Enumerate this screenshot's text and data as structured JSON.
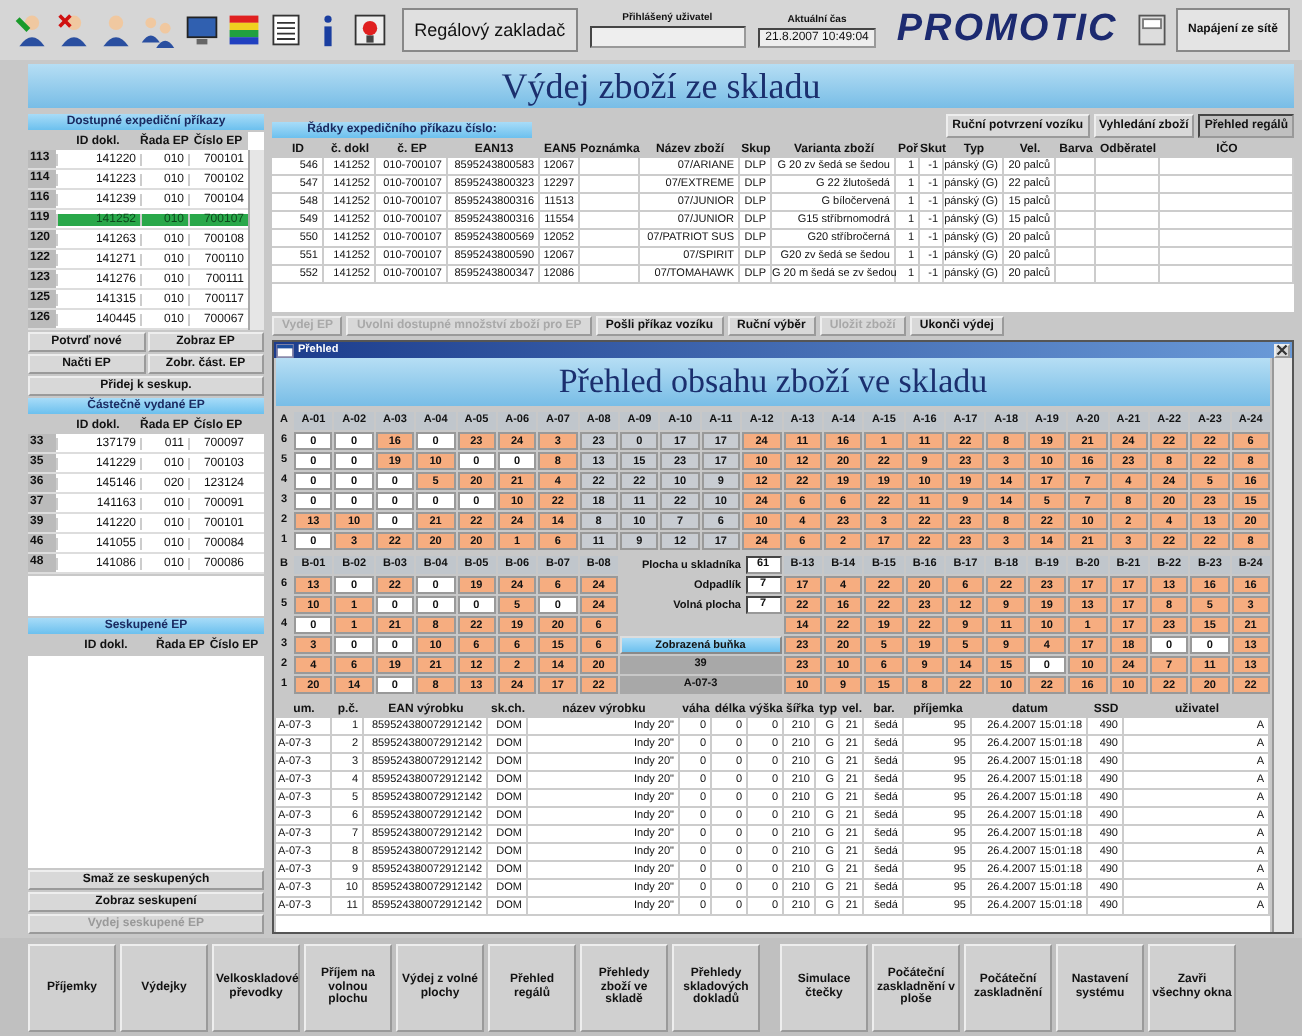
{
  "toolbar": {
    "app_label": "Regálový zakladač",
    "user_label": "Přihlášený uživatel",
    "time_label": "Aktuální čas",
    "time": "21.8.2007 10:49:04",
    "logo": "PROMOTIC",
    "power": "Napájení ze sítě"
  },
  "title": "Výdej zboží ze skladu",
  "available_orders": {
    "title": "Dostupné expediční příkazy",
    "columns": [
      "ID dokl.",
      "Řada EP",
      "Číslo EP"
    ],
    "rows": [
      {
        "n": "113",
        "cells": [
          "141220",
          "010",
          "700101"
        ],
        "selected": false
      },
      {
        "n": "114",
        "cells": [
          "141223",
          "010",
          "700102"
        ],
        "selected": false
      },
      {
        "n": "116",
        "cells": [
          "141239",
          "010",
          "700104"
        ],
        "selected": false
      },
      {
        "n": "119",
        "cells": [
          "141252",
          "010",
          "700107"
        ],
        "selected": true
      },
      {
        "n": "120",
        "cells": [
          "141263",
          "010",
          "700108"
        ],
        "selected": false
      },
      {
        "n": "122",
        "cells": [
          "141271",
          "010",
          "700110"
        ],
        "selected": false
      },
      {
        "n": "123",
        "cells": [
          "141276",
          "010",
          "700111"
        ],
        "selected": false
      },
      {
        "n": "125",
        "cells": [
          "141315",
          "010",
          "700117"
        ],
        "selected": false
      },
      {
        "n": "126",
        "cells": [
          "140445",
          "010",
          "700067"
        ],
        "selected": false
      }
    ],
    "buttons": [
      "Potvrď nové",
      "Zobraz EP",
      "Načti EP",
      "Zobr. část. EP",
      "Přidej k seskup."
    ]
  },
  "partial_orders": {
    "title": "Částečně vydané EP",
    "columns": [
      "ID dokl.",
      "Řada EP",
      "Číslo EP"
    ],
    "rows": [
      {
        "n": "33",
        "cells": [
          "137179",
          "011",
          "700097"
        ]
      },
      {
        "n": "35",
        "cells": [
          "141229",
          "010",
          "700103"
        ]
      },
      {
        "n": "36",
        "cells": [
          "145146",
          "020",
          "123124"
        ]
      },
      {
        "n": "37",
        "cells": [
          "141163",
          "010",
          "700091"
        ]
      },
      {
        "n": "39",
        "cells": [
          "141220",
          "010",
          "700101"
        ]
      },
      {
        "n": "46",
        "cells": [
          "141055",
          "010",
          "700084"
        ]
      },
      {
        "n": "48",
        "cells": [
          "141086",
          "010",
          "700086"
        ]
      }
    ]
  },
  "grouped_orders": {
    "title": "Seskupené EP",
    "columns": [
      "ID dokl.",
      "Řada EP",
      "Číslo EP"
    ],
    "buttons": [
      {
        "label": "Smaž ze seskupených",
        "disabled": false
      },
      {
        "label": "Zobraz seskupení",
        "disabled": false
      },
      {
        "label": "Vydej seskupené EP",
        "disabled": true
      }
    ]
  },
  "order_lines": {
    "title": "Řádky expedičního příkazu číslo:",
    "tabs": [
      {
        "label": "Ruční potvrzení vozíku",
        "selected": false
      },
      {
        "label": "Vyhledání zboží",
        "selected": false
      },
      {
        "label": "Přehled regálů",
        "selected": true
      }
    ],
    "columns": [
      "ID",
      "č. dokl",
      "č. EP",
      "EAN13",
      "EAN5",
      "Poznámka",
      "Název zboží",
      "Skup",
      "Varianta zboží",
      "Poř",
      "Skut",
      "Typ",
      "Vel.",
      "Barva",
      "Odběratel",
      "IČO"
    ],
    "rows": [
      [
        "546",
        "141252",
        "010-700107",
        "8595243800583",
        "12067",
        "",
        "07/ARIANE",
        "DLP",
        "G 20 zv šedá se šedou",
        "1",
        "-1",
        "pánský (G)",
        "20 palců",
        "",
        "",
        ""
      ],
      [
        "547",
        "141252",
        "010-700107",
        "8595243800323",
        "12297",
        "",
        "07/EXTREME",
        "DLP",
        "G 22 žlutošedá",
        "1",
        "-1",
        "pánský (G)",
        "22 palců",
        "",
        "",
        ""
      ],
      [
        "548",
        "141252",
        "010-700107",
        "8595243800316",
        "11513",
        "",
        "07/JUNIOR",
        "DLP",
        "G bíločervená",
        "1",
        "-1",
        "pánský (G)",
        "15 palců",
        "",
        "",
        ""
      ],
      [
        "549",
        "141252",
        "010-700107",
        "8595243800316",
        "11554",
        "",
        "07/JUNIOR",
        "DLP",
        "G15 stříbrnomodrá",
        "1",
        "-1",
        "pánský (G)",
        "15 palců",
        "",
        "",
        ""
      ],
      [
        "550",
        "141252",
        "010-700107",
        "8595243800569",
        "12052",
        "",
        "07/PATRIOT SUS",
        "DLP",
        "G20 stříbročerná",
        "1",
        "-1",
        "pánský (G)",
        "20 palců",
        "",
        "",
        ""
      ],
      [
        "551",
        "141252",
        "010-700107",
        "8595243800590",
        "12067",
        "",
        "07/SPIRIT",
        "DLP",
        "G20 zv šedá se šedou",
        "1",
        "-1",
        "pánský (G)",
        "20 palců",
        "",
        "",
        ""
      ],
      [
        "552",
        "141252",
        "010-700107",
        "8595243800347",
        "12086",
        "",
        "07/TOMAHAWK",
        "DLP",
        "G 20 m šedá se zv šedou",
        "1",
        "-1",
        "pánský (G)",
        "20 palců",
        "",
        "",
        ""
      ]
    ]
  },
  "actions": [
    {
      "label": "Vydej EP",
      "disabled": true
    },
    {
      "label": "Uvolni dostupné množství zboží pro EP",
      "disabled": true
    },
    {
      "label": "Pošli příkaz vozíku",
      "disabled": false
    },
    {
      "label": "Ruční výběr",
      "disabled": false
    },
    {
      "label": "Uložit zboží",
      "disabled": true
    },
    {
      "label": "Ukonči výdej",
      "disabled": false
    }
  ],
  "dialog": {
    "title": "Přehled",
    "heading": "Přehled obsahu zboží ve skladu",
    "rack_a": {
      "name": "A",
      "columns": [
        "A-01",
        "A-02",
        "A-03",
        "A-04",
        "A-05",
        "A-06",
        "A-07",
        "A-08",
        "A-09",
        "A-10",
        "A-11",
        "A-12",
        "A-13",
        "A-14",
        "A-15",
        "A-16",
        "A-17",
        "A-18",
        "A-19",
        "A-20",
        "A-21",
        "A-22",
        "A-23",
        "A-24"
      ],
      "rows": [
        {
          "label": "6",
          "cells": [
            {
              "value": "0",
              "kind": "free"
            },
            {
              "value": "0",
              "kind": "free"
            },
            {
              "value": "16",
              "kind": "occupied"
            },
            {
              "value": "0",
              "kind": "free"
            },
            {
              "value": "23",
              "kind": "occupied"
            },
            {
              "value": "24",
              "kind": "occupied"
            },
            {
              "value": "3",
              "kind": "occupied"
            },
            {
              "value": "23",
              "kind": "blocked"
            },
            {
              "value": "0",
              "kind": "blocked"
            },
            {
              "value": "17",
              "kind": "blocked"
            },
            {
              "value": "17",
              "kind": "blocked"
            },
            {
              "value": "24",
              "kind": "occupied"
            },
            {
              "value": "11",
              "kind": "occupied"
            },
            {
              "value": "16",
              "kind": "occupied"
            },
            {
              "value": "1",
              "kind": "occupied"
            },
            {
              "value": "11",
              "kind": "occupied"
            },
            {
              "value": "22",
              "kind": "occupied"
            },
            {
              "value": "8",
              "kind": "occupied"
            },
            {
              "value": "19",
              "kind": "occupied"
            },
            {
              "value": "21",
              "kind": "occupied"
            },
            {
              "value": "24",
              "kind": "occupied"
            },
            {
              "value": "22",
              "kind": "occupied"
            },
            {
              "value": "22",
              "kind": "occupied"
            },
            {
              "value": "6",
              "kind": "occupied"
            }
          ]
        },
        {
          "label": "5",
          "cells": [
            {
              "value": "0",
              "kind": "free"
            },
            {
              "value": "0",
              "kind": "free"
            },
            {
              "value": "19",
              "kind": "occupied"
            },
            {
              "value": "10",
              "kind": "occupied"
            },
            {
              "value": "0",
              "kind": "free"
            },
            {
              "value": "0",
              "kind": "free"
            },
            {
              "value": "8",
              "kind": "occupied"
            },
            {
              "value": "13",
              "kind": "blocked"
            },
            {
              "value": "15",
              "kind": "blocked"
            },
            {
              "value": "23",
              "kind": "blocked"
            },
            {
              "value": "17",
              "kind": "blocked"
            },
            {
              "value": "10",
              "kind": "occupied"
            },
            {
              "value": "12",
              "kind": "occupied"
            },
            {
              "value": "20",
              "kind": "occupied"
            },
            {
              "value": "22",
              "kind": "occupied"
            },
            {
              "value": "9",
              "kind": "occupied"
            },
            {
              "value": "23",
              "kind": "occupied"
            },
            {
              "value": "3",
              "kind": "occupied"
            },
            {
              "value": "10",
              "kind": "occupied"
            },
            {
              "value": "16",
              "kind": "occupied"
            },
            {
              "value": "23",
              "kind": "occupied"
            },
            {
              "value": "8",
              "kind": "occupied"
            },
            {
              "value": "22",
              "kind": "occupied"
            },
            {
              "value": "8",
              "kind": "occupied"
            }
          ]
        },
        {
          "label": "4",
          "cells": [
            {
              "value": "0",
              "kind": "free"
            },
            {
              "value": "0",
              "kind": "free"
            },
            {
              "value": "0",
              "kind": "free"
            },
            {
              "value": "5",
              "kind": "occupied"
            },
            {
              "value": "20",
              "kind": "occupied"
            },
            {
              "value": "21",
              "kind": "occupied"
            },
            {
              "value": "4",
              "kind": "occupied"
            },
            {
              "value": "22",
              "kind": "blocked"
            },
            {
              "value": "22",
              "kind": "blocked"
            },
            {
              "value": "10",
              "kind": "blocked"
            },
            {
              "value": "9",
              "kind": "blocked"
            },
            {
              "value": "12",
              "kind": "occupied"
            },
            {
              "value": "22",
              "kind": "occupied"
            },
            {
              "value": "19",
              "kind": "occupied"
            },
            {
              "value": "19",
              "kind": "occupied"
            },
            {
              "value": "10",
              "kind": "occupied"
            },
            {
              "value": "19",
              "kind": "occupied"
            },
            {
              "value": "14",
              "kind": "occupied"
            },
            {
              "value": "17",
              "kind": "occupied"
            },
            {
              "value": "7",
              "kind": "occupied"
            },
            {
              "value": "4",
              "kind": "occupied"
            },
            {
              "value": "24",
              "kind": "occupied"
            },
            {
              "value": "5",
              "kind": "occupied"
            },
            {
              "value": "16",
              "kind": "occupied"
            }
          ]
        },
        {
          "label": "3",
          "cells": [
            {
              "value": "0",
              "kind": "free"
            },
            {
              "value": "0",
              "kind": "free"
            },
            {
              "value": "0",
              "kind": "free"
            },
            {
              "value": "0",
              "kind": "free"
            },
            {
              "value": "0",
              "kind": "free"
            },
            {
              "value": "10",
              "kind": "occupied"
            },
            {
              "value": "22",
              "kind": "occupied"
            },
            {
              "value": "18",
              "kind": "blocked"
            },
            {
              "value": "11",
              "kind": "blocked"
            },
            {
              "value": "22",
              "kind": "blocked"
            },
            {
              "value": "10",
              "kind": "blocked"
            },
            {
              "value": "24",
              "kind": "occupied"
            },
            {
              "value": "6",
              "kind": "occupied"
            },
            {
              "value": "6",
              "kind": "occupied"
            },
            {
              "value": "22",
              "kind": "occupied"
            },
            {
              "value": "11",
              "kind": "occupied"
            },
            {
              "value": "9",
              "kind": "occupied"
            },
            {
              "value": "14",
              "kind": "occupied"
            },
            {
              "value": "5",
              "kind": "occupied"
            },
            {
              "value": "7",
              "kind": "occupied"
            },
            {
              "value": "8",
              "kind": "occupied"
            },
            {
              "value": "20",
              "kind": "occupied"
            },
            {
              "value": "23",
              "kind": "occupied"
            },
            {
              "value": "15",
              "kind": "occupied"
            }
          ]
        },
        {
          "label": "2",
          "cells": [
            {
              "value": "13",
              "kind": "occupied"
            },
            {
              "value": "10",
              "kind": "occupied"
            },
            {
              "value": "0",
              "kind": "free"
            },
            {
              "value": "21",
              "kind": "occupied"
            },
            {
              "value": "22",
              "kind": "occupied"
            },
            {
              "value": "24",
              "kind": "occupied"
            },
            {
              "value": "14",
              "kind": "occupied"
            },
            {
              "value": "8",
              "kind": "blocked"
            },
            {
              "value": "10",
              "kind": "blocked"
            },
            {
              "value": "7",
              "kind": "blocked"
            },
            {
              "value": "6",
              "kind": "blocked"
            },
            {
              "value": "10",
              "kind": "occupied"
            },
            {
              "value": "4",
              "kind": "occupied"
            },
            {
              "value": "23",
              "kind": "occupied"
            },
            {
              "value": "3",
              "kind": "occupied"
            },
            {
              "value": "22",
              "kind": "occupied"
            },
            {
              "value": "23",
              "kind": "occupied"
            },
            {
              "value": "8",
              "kind": "occupied"
            },
            {
              "value": "22",
              "kind": "occupied"
            },
            {
              "value": "10",
              "kind": "occupied"
            },
            {
              "value": "2",
              "kind": "occupied"
            },
            {
              "value": "4",
              "kind": "occupied"
            },
            {
              "value": "13",
              "kind": "occupied"
            },
            {
              "value": "20",
              "kind": "occupied"
            }
          ]
        },
        {
          "label": "1",
          "cells": [
            {
              "value": "0",
              "kind": "free"
            },
            {
              "value": "3",
              "kind": "occupied"
            },
            {
              "value": "22",
              "kind": "occupied"
            },
            {
              "value": "20",
              "kind": "occupied"
            },
            {
              "value": "20",
              "kind": "occupied"
            },
            {
              "value": "1",
              "kind": "occupied"
            },
            {
              "value": "6",
              "kind": "occupied"
            },
            {
              "value": "11",
              "kind": "blocked"
            },
            {
              "value": "9",
              "kind": "blocked"
            },
            {
              "value": "12",
              "kind": "blocked"
            },
            {
              "value": "17",
              "kind": "blocked"
            },
            {
              "value": "24",
              "kind": "occupied"
            },
            {
              "value": "6",
              "kind": "occupied"
            },
            {
              "value": "2",
              "kind": "occupied"
            },
            {
              "value": "17",
              "kind": "occupied"
            },
            {
              "value": "22",
              "kind": "occupied"
            },
            {
              "value": "23",
              "kind": "occupied"
            },
            {
              "value": "3",
              "kind": "occupied"
            },
            {
              "value": "14",
              "kind": "occupied"
            },
            {
              "value": "21",
              "kind": "occupied"
            },
            {
              "value": "3",
              "kind": "occupied"
            },
            {
              "value": "22",
              "kind": "occupied"
            },
            {
              "value": "22",
              "kind": "occupied"
            },
            {
              "value": "8",
              "kind": "occupied"
            }
          ]
        }
      ]
    },
    "rack_b": {
      "name": "B",
      "columns": [
        "B-01",
        "B-02",
        "B-03",
        "B-04",
        "B-05",
        "B-06",
        "B-07",
        "B-08",
        "B-13",
        "B-14",
        "B-15",
        "B-16",
        "B-17",
        "B-18",
        "B-19",
        "B-20",
        "B-21",
        "B-22",
        "B-23",
        "B-24"
      ],
      "rows": [
        {
          "label": "6",
          "cells": [
            {
              "value": "13",
              "kind": "occupied"
            },
            {
              "value": "0",
              "kind": "free"
            },
            {
              "value": "22",
              "kind": "occupied"
            },
            {
              "value": "0",
              "kind": "free"
            },
            {
              "value": "19",
              "kind": "occupied"
            },
            {
              "value": "24",
              "kind": "occupied"
            },
            {
              "value": "6",
              "kind": "occupied"
            },
            {
              "value": "24",
              "kind": "occupied"
            },
            {
              "value": "17",
              "kind": "occupied"
            },
            {
              "value": "4",
              "kind": "occupied"
            },
            {
              "value": "22",
              "kind": "occupied"
            },
            {
              "value": "20",
              "kind": "occupied"
            },
            {
              "value": "6",
              "kind": "occupied"
            },
            {
              "value": "22",
              "kind": "occupied"
            },
            {
              "value": "23",
              "kind": "occupied"
            },
            {
              "value": "17",
              "kind": "occupied"
            },
            {
              "value": "17",
              "kind": "occupied"
            },
            {
              "value": "13",
              "kind": "occupied"
            },
            {
              "value": "16",
              "kind": "occupied"
            },
            {
              "value": "16",
              "kind": "occupied"
            }
          ]
        },
        {
          "label": "5",
          "cells": [
            {
              "value": "10",
              "kind": "occupied"
            },
            {
              "value": "1",
              "kind": "occupied"
            },
            {
              "value": "0",
              "kind": "free"
            },
            {
              "value": "0",
              "kind": "free"
            },
            {
              "value": "0",
              "kind": "free"
            },
            {
              "value": "5",
              "kind": "occupied"
            },
            {
              "value": "0",
              "kind": "free"
            },
            {
              "value": "24",
              "kind": "occupied"
            },
            {
              "value": "22",
              "kind": "occupied"
            },
            {
              "value": "16",
              "kind": "occupied"
            },
            {
              "value": "22",
              "kind": "occupied"
            },
            {
              "value": "23",
              "kind": "occupied"
            },
            {
              "value": "12",
              "kind": "occupied"
            },
            {
              "value": "9",
              "kind": "occupied"
            },
            {
              "value": "19",
              "kind": "occupied"
            },
            {
              "value": "13",
              "kind": "occupied"
            },
            {
              "value": "17",
              "kind": "occupied"
            },
            {
              "value": "8",
              "kind": "occupied"
            },
            {
              "value": "5",
              "kind": "occupied"
            },
            {
              "value": "3",
              "kind": "occupied"
            }
          ]
        },
        {
          "label": "4",
          "cells": [
            {
              "value": "0",
              "kind": "free"
            },
            {
              "value": "1",
              "kind": "occupied"
            },
            {
              "value": "21",
              "kind": "occupied"
            },
            {
              "value": "8",
              "kind": "occupied"
            },
            {
              "value": "22",
              "kind": "occupied"
            },
            {
              "value": "19",
              "kind": "occupied"
            },
            {
              "value": "20",
              "kind": "occupied"
            },
            {
              "value": "6",
              "kind": "occupied"
            },
            {
              "value": "14",
              "kind": "occupied"
            },
            {
              "value": "22",
              "kind": "occupied"
            },
            {
              "value": "19",
              "kind": "occupied"
            },
            {
              "value": "22",
              "kind": "occupied"
            },
            {
              "value": "9",
              "kind": "occupied"
            },
            {
              "value": "11",
              "kind": "occupied"
            },
            {
              "value": "10",
              "kind": "occupied"
            },
            {
              "value": "1",
              "kind": "occupied"
            },
            {
              "value": "17",
              "kind": "occupied"
            },
            {
              "value": "23",
              "kind": "occupied"
            },
            {
              "value": "15",
              "kind": "occupied"
            },
            {
              "value": "21",
              "kind": "occupied"
            }
          ]
        },
        {
          "label": "3",
          "cells": [
            {
              "value": "3",
              "kind": "occupied"
            },
            {
              "value": "0",
              "kind": "free"
            },
            {
              "value": "0",
              "kind": "free"
            },
            {
              "value": "10",
              "kind": "occupied"
            },
            {
              "value": "6",
              "kind": "occupied"
            },
            {
              "value": "6",
              "kind": "occupied"
            },
            {
              "value": "15",
              "kind": "occupied"
            },
            {
              "value": "6",
              "kind": "occupied"
            },
            {
              "value": "23",
              "kind": "occupied"
            },
            {
              "value": "20",
              "kind": "occupied"
            },
            {
              "value": "5",
              "kind": "occupied"
            },
            {
              "value": "19",
              "kind": "occupied"
            },
            {
              "value": "5",
              "kind": "occupied"
            },
            {
              "value": "9",
              "kind": "occupied"
            },
            {
              "value": "4",
              "kind": "occupied"
            },
            {
              "value": "17",
              "kind": "occupied"
            },
            {
              "value": "18",
              "kind": "occupied"
            },
            {
              "value": "0",
              "kind": "free"
            },
            {
              "value": "0",
              "kind": "free"
            },
            {
              "value": "13",
              "kind": "occupied"
            }
          ]
        },
        {
          "label": "2",
          "cells": [
            {
              "value": "4",
              "kind": "occupied"
            },
            {
              "value": "6",
              "kind": "occupied"
            },
            {
              "value": "19",
              "kind": "occupied"
            },
            {
              "value": "21",
              "kind": "occupied"
            },
            {
              "value": "12",
              "kind": "occupied"
            },
            {
              "value": "2",
              "kind": "occupied"
            },
            {
              "value": "14",
              "kind": "occupied"
            },
            {
              "value": "20",
              "kind": "occupied"
            },
            {
              "value": "23",
              "kind": "occupied"
            },
            {
              "value": "10",
              "kind": "occupied"
            },
            {
              "value": "6",
              "kind": "occupied"
            },
            {
              "value": "9",
              "kind": "occupied"
            },
            {
              "value": "14",
              "kind": "occupied"
            },
            {
              "value": "15",
              "kind": "occupied"
            },
            {
              "value": "0",
              "kind": "free"
            },
            {
              "value": "10",
              "kind": "occupied"
            },
            {
              "value": "24",
              "kind": "occupied"
            },
            {
              "value": "7",
              "kind": "occupied"
            },
            {
              "value": "11",
              "kind": "occupied"
            },
            {
              "value": "13",
              "kind": "occupied"
            }
          ]
        },
        {
          "label": "1",
          "cells": [
            {
              "value": "20",
              "kind": "occupied"
            },
            {
              "value": "14",
              "kind": "occupied"
            },
            {
              "value": "0",
              "kind": "free"
            },
            {
              "value": "8",
              "kind": "occupied"
            },
            {
              "value": "13",
              "kind": "occupied"
            },
            {
              "value": "24",
              "kind": "occupied"
            },
            {
              "value": "17",
              "kind": "occupied"
            },
            {
              "value": "22",
              "kind": "occupied"
            },
            {
              "value": "10",
              "kind": "occupied"
            },
            {
              "value": "9",
              "kind": "occupied"
            },
            {
              "value": "15",
              "kind": "occupied"
            },
            {
              "value": "8",
              "kind": "occupied"
            },
            {
              "value": "22",
              "kind": "occupied"
            },
            {
              "value": "10",
              "kind": "occupied"
            },
            {
              "value": "22",
              "kind": "occupied"
            },
            {
              "value": "16",
              "kind": "occupied"
            },
            {
              "value": "10",
              "kind": "occupied"
            },
            {
              "value": "22",
              "kind": "occupied"
            },
            {
              "value": "20",
              "kind": "occupied"
            },
            {
              "value": "22",
              "kind": "occupied"
            }
          ]
        }
      ]
    },
    "info": {
      "operator_area_label": "Plocha u skladníka",
      "operator_area": "61",
      "waste_label": "Odpadlík",
      "waste": "7",
      "free_area_label": "Volná plocha",
      "free_area": "7",
      "shown_cell_button": "Zobrazená buňka",
      "shown_cell_count": "39",
      "shown_cell": "A-07-3"
    },
    "contents": {
      "columns": [
        "um.",
        "p.č.",
        "EAN výrobku",
        "sk.ch.",
        "název výrobku",
        "váha",
        "délka",
        "výška",
        "šířka",
        "typ",
        "vel.",
        "bar.",
        "příjemka",
        "datum",
        "SSD",
        "uživatel"
      ],
      "rows": [
        [
          "A-07-3",
          "1",
          "859524380072912142",
          "DOM",
          "Indy 20\"",
          "0",
          "0",
          "0",
          "210",
          "G",
          "21",
          "šedá",
          "95",
          "26.4.2007 15:01:18",
          "490",
          "A"
        ],
        [
          "A-07-3",
          "2",
          "859524380072912142",
          "DOM",
          "Indy 20\"",
          "0",
          "0",
          "0",
          "210",
          "G",
          "21",
          "šedá",
          "95",
          "26.4.2007 15:01:18",
          "490",
          "A"
        ],
        [
          "A-07-3",
          "3",
          "859524380072912142",
          "DOM",
          "Indy 20\"",
          "0",
          "0",
          "0",
          "210",
          "G",
          "21",
          "šedá",
          "95",
          "26.4.2007 15:01:18",
          "490",
          "A"
        ],
        [
          "A-07-3",
          "4",
          "859524380072912142",
          "DOM",
          "Indy 20\"",
          "0",
          "0",
          "0",
          "210",
          "G",
          "21",
          "šedá",
          "95",
          "26.4.2007 15:01:18",
          "490",
          "A"
        ],
        [
          "A-07-3",
          "5",
          "859524380072912142",
          "DOM",
          "Indy 20\"",
          "0",
          "0",
          "0",
          "210",
          "G",
          "21",
          "šedá",
          "95",
          "26.4.2007 15:01:18",
          "490",
          "A"
        ],
        [
          "A-07-3",
          "6",
          "859524380072912142",
          "DOM",
          "Indy 20\"",
          "0",
          "0",
          "0",
          "210",
          "G",
          "21",
          "šedá",
          "95",
          "26.4.2007 15:01:18",
          "490",
          "A"
        ],
        [
          "A-07-3",
          "7",
          "859524380072912142",
          "DOM",
          "Indy 20\"",
          "0",
          "0",
          "0",
          "210",
          "G",
          "21",
          "šedá",
          "95",
          "26.4.2007 15:01:18",
          "490",
          "A"
        ],
        [
          "A-07-3",
          "8",
          "859524380072912142",
          "DOM",
          "Indy 20\"",
          "0",
          "0",
          "0",
          "210",
          "G",
          "21",
          "šedá",
          "95",
          "26.4.2007 15:01:18",
          "490",
          "A"
        ],
        [
          "A-07-3",
          "9",
          "859524380072912142",
          "DOM",
          "Indy 20\"",
          "0",
          "0",
          "0",
          "210",
          "G",
          "21",
          "šedá",
          "95",
          "26.4.2007 15:01:18",
          "490",
          "A"
        ],
        [
          "A-07-3",
          "10",
          "859524380072912142",
          "DOM",
          "Indy 20\"",
          "0",
          "0",
          "0",
          "210",
          "G",
          "21",
          "šedá",
          "95",
          "26.4.2007 15:01:18",
          "490",
          "A"
        ],
        [
          "A-07-3",
          "11",
          "859524380072912142",
          "DOM",
          "Indy 20\"",
          "0",
          "0",
          "0",
          "210",
          "G",
          "21",
          "šedá",
          "95",
          "26.4.2007 15:01:18",
          "490",
          "A"
        ]
      ]
    }
  },
  "nav_groups": [
    {
      "buttons": [
        "Příjemky",
        "Výdejky",
        "Velkoskladové převodky",
        "Příjem na volnou plochu",
        "Výdej z volné plochy",
        "Přehled regálů",
        "Přehledy zboží ve skladě",
        "Přehledy skladových dokladů"
      ]
    },
    {
      "buttons": [
        "Simulace čtečky",
        "Počáteční zaskladnění v ploše",
        "Počáteční zaskladnění",
        "Nastavení systému",
        "Zavři všechny okna"
      ]
    }
  ]
}
